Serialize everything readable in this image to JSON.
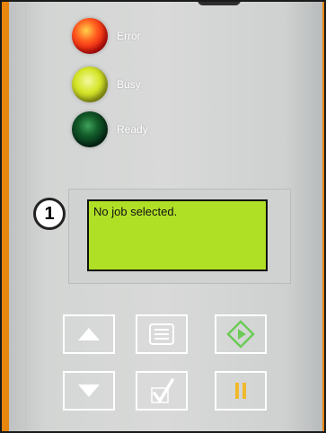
{
  "indicators": [
    {
      "label": "Error",
      "color": "#ff3b1f"
    },
    {
      "label": "Busy",
      "color": "#d2e51c"
    },
    {
      "label": "Ready",
      "color": "#0a3d18"
    }
  ],
  "display": {
    "message": "No job selected."
  },
  "callout": {
    "number": "1"
  },
  "buttons": {
    "up": {
      "icon": "arrow-up-icon"
    },
    "menu": {
      "icon": "menu-list-icon"
    },
    "start": {
      "icon": "start-diamond-icon",
      "color": "#6ccb57"
    },
    "down": {
      "icon": "arrow-down-icon"
    },
    "confirm": {
      "icon": "checkmark-icon"
    },
    "pause": {
      "icon": "pause-icon",
      "color": "#f0b82c"
    }
  }
}
